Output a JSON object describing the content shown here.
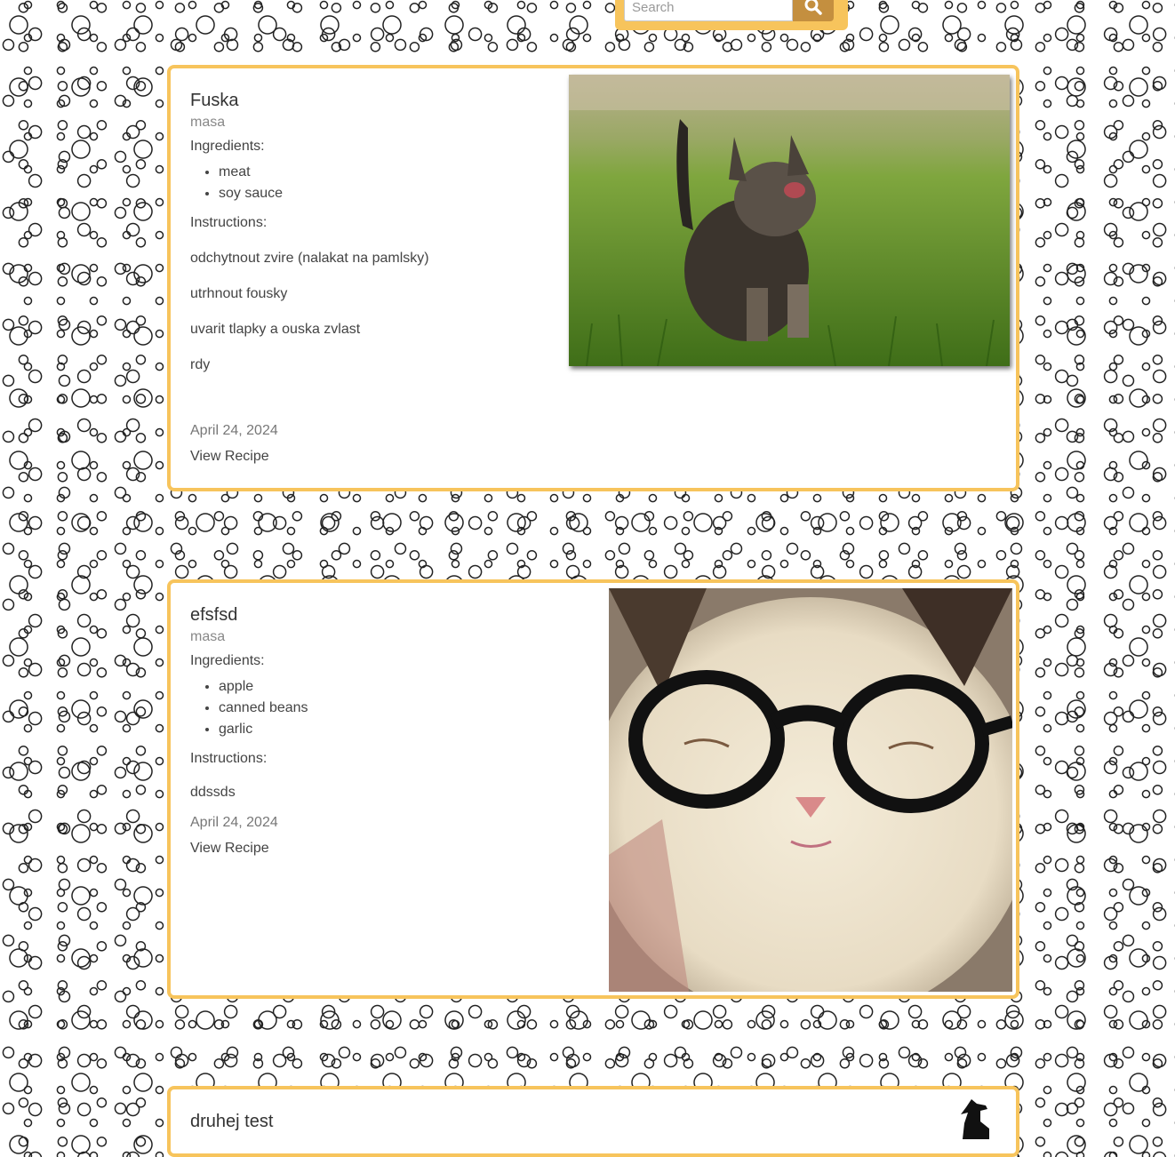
{
  "search": {
    "placeholder": "Search",
    "icon": "search-icon"
  },
  "colors": {
    "accent": "#f7c45c",
    "search_button": "#c48f3f"
  },
  "recipes": [
    {
      "title": "Fuska",
      "category": "masa",
      "ingredients_label": "Ingredients:",
      "ingredients": [
        "meat",
        "soy sauce"
      ],
      "instructions_label": "Instructions:",
      "steps": [
        "odchytnout zvire (nalakat na pamlsky)",
        "utrhnout fousky",
        "uvarit tlapky a ouska zvlast",
        "rdy"
      ],
      "date": "April 24, 2024",
      "link_label": "View Recipe",
      "image": "kitten-meowing-in-grass-photo"
    },
    {
      "title": "efsfsd",
      "category": "masa",
      "ingredients_label": "Ingredients:",
      "ingredients": [
        "apple",
        "canned beans",
        "garlic"
      ],
      "instructions_label": "Instructions:",
      "steps": [
        "ddssds"
      ],
      "date": "April 24, 2024",
      "link_label": "View Recipe",
      "image": "white-cat-with-glasses-photo"
    },
    {
      "title": "druhej test",
      "image": "dog-silhouette-icon"
    }
  ]
}
